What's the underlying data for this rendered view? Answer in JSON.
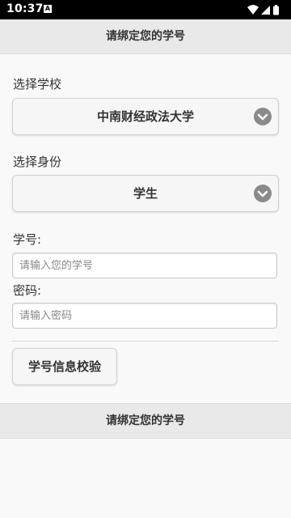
{
  "status_bar": {
    "time": "10:37",
    "notification_glyph": "A",
    "icons": [
      "wifi-icon",
      "cell-signal-icon",
      "battery-icon"
    ]
  },
  "header": {
    "title": "请绑定您的学号"
  },
  "form": {
    "school_label": "选择学校",
    "school_value": "中南财经政法大学",
    "identity_label": "选择身份",
    "identity_value": "学生",
    "student_id_label": "学号:",
    "student_id_placeholder": "请输入您的学号",
    "password_label": "密码:",
    "password_placeholder": "请输入密码",
    "verify_button": "学号信息校验"
  },
  "footer": {
    "title": "请绑定您的学号"
  },
  "colors": {
    "chevron_circle": "#8a8a8a",
    "header_bg": "#e9e9e9",
    "page_bg": "#f9f9f9"
  }
}
